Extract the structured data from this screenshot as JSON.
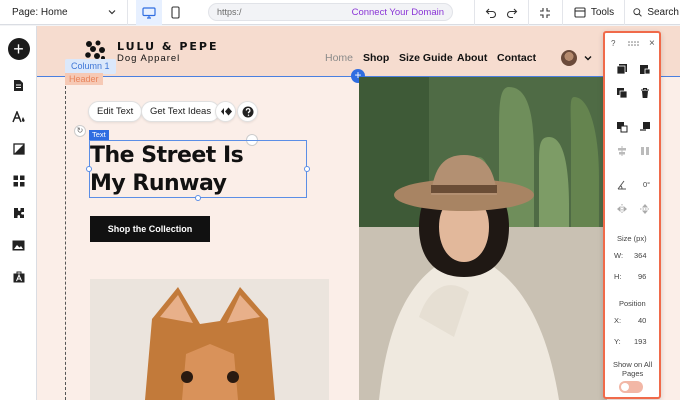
{
  "topbar": {
    "page_label": "Page: Home",
    "url_text": "https:/",
    "connect_label": "Connect Your Domain",
    "tools_label": "Tools",
    "search_label": "Search"
  },
  "site": {
    "brand": "LULU & PEPE",
    "brand_sub": "Dog Apparel",
    "nav": [
      "Home",
      "Shop",
      "Size Guide",
      "About",
      "Contact"
    ]
  },
  "editor": {
    "column_tag": "Column 1",
    "header_tag": "Header",
    "edit_text": "Edit Text",
    "get_text_ideas": "Get Text Ideas",
    "text_tag": "Text",
    "headline_line1": "The Street Is",
    "headline_line2": "My Runway",
    "cta": "Shop the Collection"
  },
  "panel": {
    "help": "?",
    "close": "×",
    "rotation": "0°",
    "size_label": "Size (px)",
    "w_label": "W:",
    "w_value": "364",
    "h_label": "H:",
    "h_value": "96",
    "position_label": "Position",
    "x_label": "X:",
    "x_value": "40",
    "y_label": "Y:",
    "y_value": "193",
    "show_all_line1": "Show on All",
    "show_all_line2": "Pages"
  },
  "colors": {
    "accent": "#2f6de1",
    "panel_border": "#f06a4a",
    "connect": "#8a35d6",
    "header_bg": "#f6dccf"
  }
}
